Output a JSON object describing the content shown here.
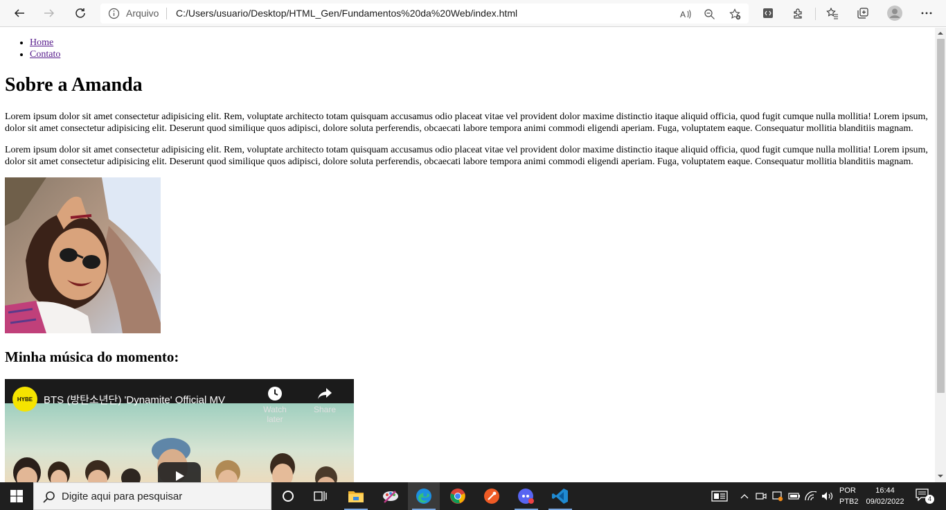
{
  "browser": {
    "address_scheme": "Arquivo",
    "url": "C:/Users/usuario/Desktop/HTML_Gen/Fundamentos%20da%20Web/index.html",
    "icons": [
      "back-icon",
      "forward-icon",
      "refresh-icon",
      "info-icon",
      "read-aloud-icon",
      "zoom-out-icon",
      "add-favorite-icon",
      "devtools-icon",
      "extensions-icon",
      "favorites-icon",
      "collections-icon",
      "profile-icon",
      "more-icon"
    ]
  },
  "page": {
    "nav": [
      {
        "label": "Home"
      },
      {
        "label": "Contato"
      }
    ],
    "title": "Sobre a Amanda",
    "paragraphs": [
      "Lorem ipsum dolor sit amet consectetur adipisicing elit. Rem, voluptate architecto totam quisquam accusamus odio placeat vitae vel provident dolor maxime distinctio itaque aliquid officia, quod fugit cumque nulla mollitia! Lorem ipsum, dolor sit amet consectetur adipisicing elit. Deserunt quod similique quos adipisci, dolore soluta perferendis, obcaecati labore tempora animi commodi eligendi aperiam. Fuga, voluptatem eaque. Consequatur mollitia blanditiis magnam.",
      "Lorem ipsum dolor sit amet consectetur adipisicing elit. Rem, voluptate architecto totam quisquam accusamus odio placeat vitae vel provident dolor maxime distinctio itaque aliquid officia, quod fugit cumque nulla mollitia! Lorem ipsum, dolor sit amet consectetur adipisicing elit. Deserunt quod similique quos adipisci, dolore soluta perferendis, obcaecati labore tempora animi commodi eligendi aperiam. Fuga, voluptatem eaque. Consequatur mollitia blanditiis magnam."
    ],
    "music_heading": "Minha música do momento:",
    "video": {
      "channel_logo": "HYBE",
      "title": "BTS (방탄소년단) 'Dynamite' Official MV",
      "watch_later": "Watch later",
      "share": "Share"
    }
  },
  "taskbar": {
    "search_placeholder": "Digite aqui para pesquisar",
    "apps": [
      "task-view-icon",
      "file-explorer-icon",
      "paint-icon",
      "edge-icon",
      "chrome-icon",
      "postman-icon",
      "discord-icon",
      "vscode-icon"
    ],
    "lang_line1": "POR",
    "lang_line2": "PTB2",
    "time": "16:44",
    "date": "09/02/2022",
    "notification_count": "4"
  }
}
